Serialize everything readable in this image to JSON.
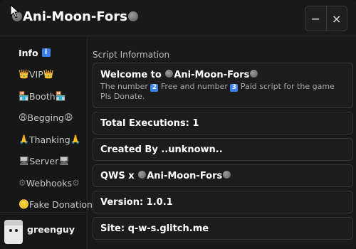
{
  "window": {
    "title": "Ani-Moon-Fors",
    "minimize_label": "−",
    "close_label": "×"
  },
  "sidebar": {
    "items": [
      {
        "label": "Info",
        "prefix": "",
        "suffix": "",
        "badge": "i"
      },
      {
        "label": "VIP",
        "prefix": "👑",
        "suffix": "👑"
      },
      {
        "label": "Booth",
        "prefix": "🏪",
        "suffix": "🏪"
      },
      {
        "label": "Begging",
        "prefix": "😩",
        "suffix": "😩"
      },
      {
        "label": "Thanking",
        "prefix": "🙏",
        "suffix": "🙏"
      },
      {
        "label": "Server",
        "prefix": "🖥",
        "suffix": "🖥"
      },
      {
        "label": "Webhooks",
        "prefix": "⚙",
        "suffix": "⚙"
      },
      {
        "label": "Fake Donation",
        "prefix": "🪙",
        "suffix": ""
      }
    ],
    "user": {
      "name": "greenguy"
    }
  },
  "main": {
    "section_title": "Script Information",
    "welcome": {
      "title_prefix": "Welcome to",
      "title_name": "Ani-Moon-Fors",
      "desc_a": "The number",
      "desc_n1": "2",
      "desc_b": "Free and number",
      "desc_n2": "3",
      "desc_c": "Paid script for the game Pls Donate."
    },
    "executions": "Total Executions: 1",
    "created_by": "Created By ..unknown..",
    "qws_prefix": "QWS x",
    "qws_name": "Ani-Moon-Fors",
    "version": "Version: 1.0.1",
    "site": "Site: q-w-s.glitch.me"
  },
  "colors": {
    "background": "#191919",
    "card": "#1c1c1c",
    "border": "#363636",
    "accent_badge": "#3c7ff0"
  }
}
